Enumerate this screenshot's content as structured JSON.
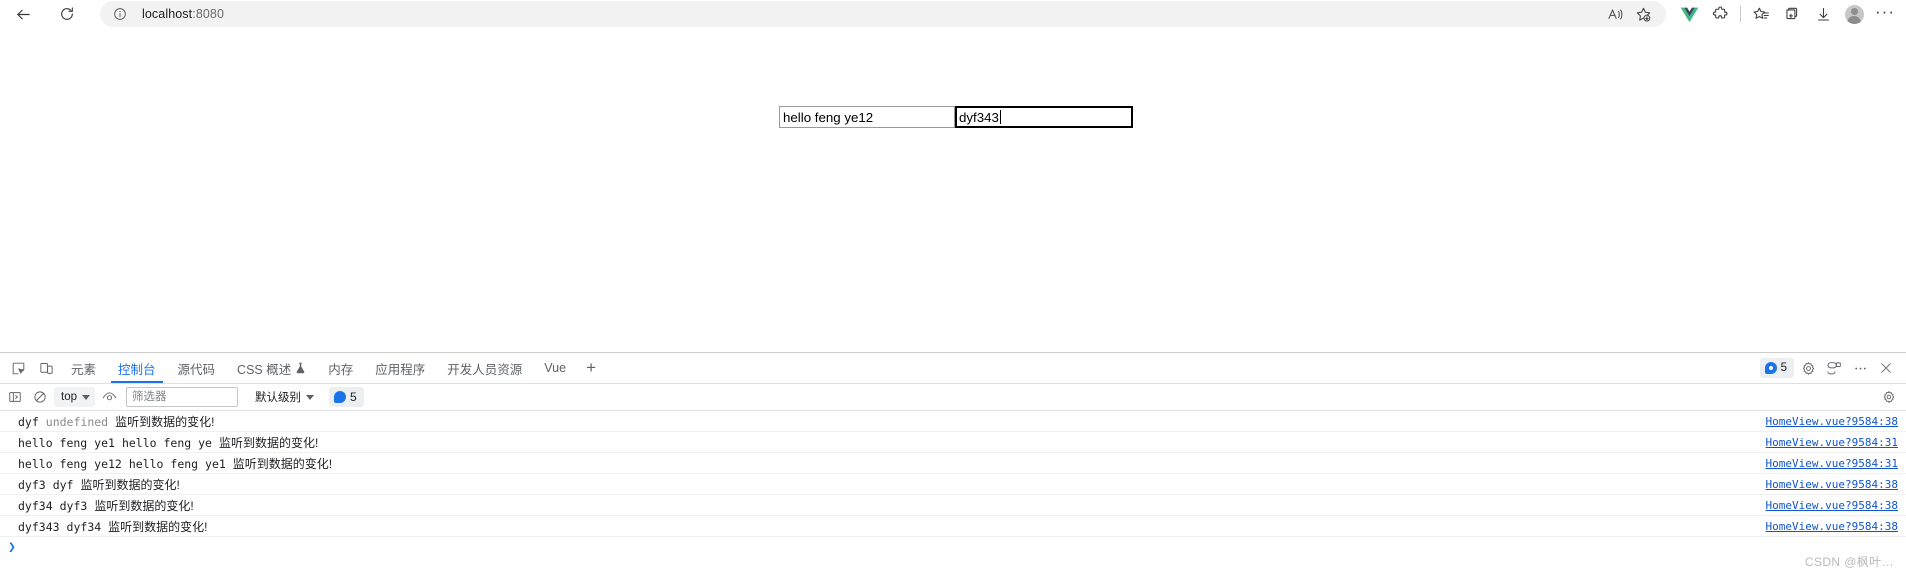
{
  "browser": {
    "back_label": "后退",
    "reload_label": "刷新",
    "address": {
      "host": "localhost",
      "port": ":8080",
      "info_icon": "info-circle-icon"
    },
    "omnibox_actions": [
      {
        "name": "read-aloud-icon",
        "label": "朗读此页面"
      },
      {
        "name": "add-favorite-icon",
        "label": "将此页添加到收藏夹"
      }
    ],
    "toolbar_icons": [
      {
        "name": "vue-devtools-icon",
        "label": "Vue.js devtools",
        "color": "#42b883"
      },
      {
        "name": "extensions-puzzle-icon",
        "label": "扩展"
      },
      {
        "name": "favorites-icon",
        "label": "收藏夹"
      },
      {
        "name": "collections-icon",
        "label": "集锦"
      },
      {
        "name": "downloads-icon",
        "label": "下载"
      },
      {
        "name": "profile-avatar-icon",
        "label": "个人资料"
      },
      {
        "name": "settings-more-icon",
        "label": "设置及其他"
      }
    ]
  },
  "page": {
    "inputs": [
      {
        "name": "first-text-input",
        "value": "hello feng ye12",
        "focused": false
      },
      {
        "name": "second-text-input",
        "value": "dyf343",
        "focused": true
      }
    ]
  },
  "devtools": {
    "panel_icons": [
      {
        "name": "inspect-element-icon",
        "label": "检查元素"
      },
      {
        "name": "device-toolbar-icon",
        "label": "切换设备工具栏"
      }
    ],
    "tabs": [
      {
        "label": "元素",
        "active": false,
        "icon": null
      },
      {
        "label": "控制台",
        "active": true,
        "icon": null
      },
      {
        "label": "源代码",
        "active": false,
        "icon": null
      },
      {
        "label": "CSS 概述",
        "active": false,
        "icon": "flask-icon"
      },
      {
        "label": "内存",
        "active": false,
        "icon": null
      },
      {
        "label": "应用程序",
        "active": false,
        "icon": null
      },
      {
        "label": "开发人员资源",
        "active": false,
        "icon": null
      },
      {
        "label": "Vue",
        "active": false,
        "icon": null
      }
    ],
    "add_tab_label": "+",
    "tabbar_right": {
      "message_count": "5",
      "icons": [
        {
          "name": "settings-gear-icon",
          "label": "设置"
        },
        {
          "name": "customize-devtools-icon",
          "label": "自定义"
        },
        {
          "name": "more-options-icon",
          "label": "更多选项"
        },
        {
          "name": "close-devtools-icon",
          "label": "关闭"
        }
      ]
    },
    "filterbar": {
      "sidebar_toggle": "console-sidebar-icon",
      "clear_console": "clear-console-icon",
      "context": "top",
      "live_expression": "eye-icon",
      "filter_placeholder": "筛选器",
      "filter_value": "",
      "level": "默认级别",
      "issue_count": "5",
      "settings_icon": "console-settings-icon"
    },
    "console_logs": [
      {
        "tokens": [
          {
            "text": "dyf",
            "style": "normal"
          },
          {
            "text": "undefined",
            "style": "undefined"
          }
        ],
        "message": "监听到数据的变化!",
        "source": "HomeView.vue?9584:38"
      },
      {
        "tokens": [
          {
            "text": "hello feng ye1",
            "style": "normal"
          },
          {
            "text": "hello feng ye",
            "style": "normal"
          }
        ],
        "message": "监听到数据的变化!",
        "source": "HomeView.vue?9584:31"
      },
      {
        "tokens": [
          {
            "text": "hello feng ye12",
            "style": "normal"
          },
          {
            "text": "hello feng ye1",
            "style": "normal"
          }
        ],
        "message": "监听到数据的变化!",
        "source": "HomeView.vue?9584:31"
      },
      {
        "tokens": [
          {
            "text": "dyf3",
            "style": "normal"
          },
          {
            "text": "dyf",
            "style": "normal"
          }
        ],
        "message": "监听到数据的变化!",
        "source": "HomeView.vue?9584:38"
      },
      {
        "tokens": [
          {
            "text": "dyf34",
            "style": "normal"
          },
          {
            "text": "dyf3",
            "style": "normal"
          }
        ],
        "message": "监听到数据的变化!",
        "source": "HomeView.vue?9584:38"
      },
      {
        "tokens": [
          {
            "text": "dyf343",
            "style": "normal"
          },
          {
            "text": "dyf34",
            "style": "normal"
          }
        ],
        "message": "监听到数据的变化!",
        "source": "HomeView.vue?9584:38"
      }
    ],
    "prompt_symbol": "❯"
  },
  "watermark": "CSDN @枫叶…"
}
